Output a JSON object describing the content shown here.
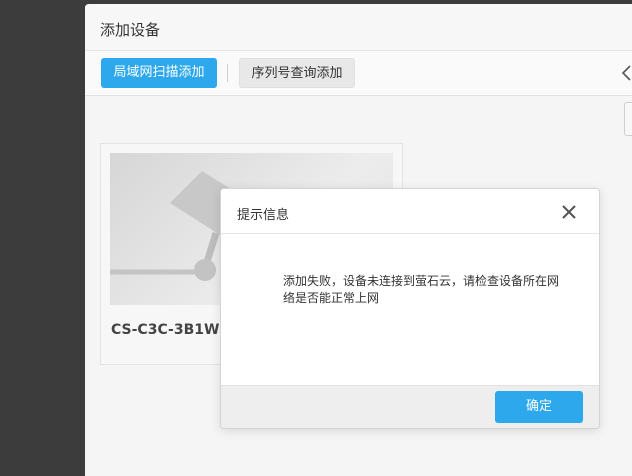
{
  "window": {
    "title": "添加设备"
  },
  "toolbar": {
    "lan_scan_label": "局域网扫描添加",
    "serial_query_label": "序列号查询添加"
  },
  "device": {
    "name": "CS-C3C-3B1WI"
  },
  "dialog": {
    "title": "提示信息",
    "message": "添加失败，设备未连接到萤石云，请检查设备所在网络是否能正常上网",
    "ok_label": "确定"
  },
  "colors": {
    "accent": "#2ea8ec"
  }
}
